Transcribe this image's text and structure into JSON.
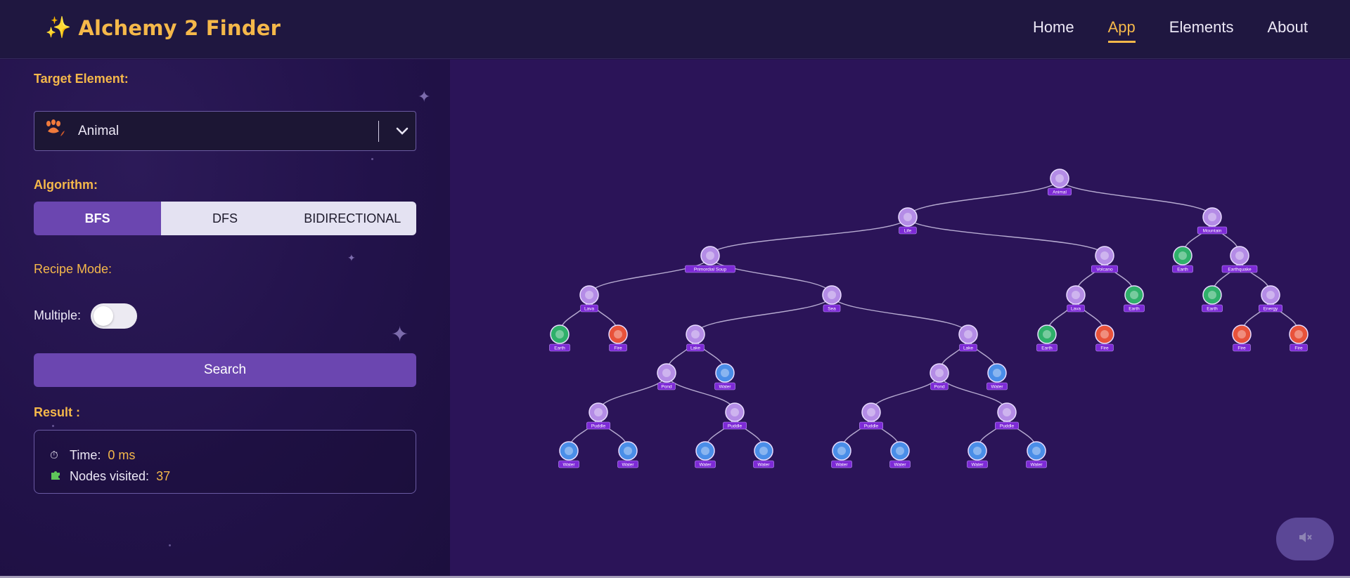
{
  "brand": {
    "icon": "sparkles-icon",
    "title": "Alchemy 2 Finder"
  },
  "nav": {
    "links": [
      "Home",
      "App",
      "Elements",
      "About"
    ],
    "active": "App"
  },
  "sidebar": {
    "target_label": "Target Element:",
    "target_value": "Animal",
    "target_icon": "paw-icon",
    "algorithm_label": "Algorithm:",
    "algorithms": [
      "BFS",
      "DFS",
      "BIDIRECTIONAL"
    ],
    "algorithm_selected": "BFS",
    "recipe_mode_label": "Recipe Mode:",
    "multiple_label": "Multiple:",
    "multiple_enabled": false,
    "search_label": "Search",
    "result_label": "Result :",
    "time_label": "Time:",
    "time_value": "0 ms",
    "time_icon": "stopwatch-icon",
    "nodes_label": "Nodes visited:",
    "nodes_value": "37",
    "nodes_icon": "puzzle-icon"
  },
  "tree": {
    "nodes": [
      {
        "id": "animal",
        "label": "Animal",
        "kind": "compound",
        "parent": null
      },
      {
        "id": "life",
        "label": "Life",
        "kind": "compound",
        "parent": "animal"
      },
      {
        "id": "mountain",
        "label": "Mountain",
        "kind": "compound",
        "parent": "animal"
      },
      {
        "id": "soup",
        "label": "Primordial Soup",
        "kind": "compound",
        "parent": "life"
      },
      {
        "id": "volcano",
        "label": "Volcano",
        "kind": "compound",
        "parent": "life"
      },
      {
        "id": "m_earth",
        "label": "Earth",
        "kind": "earth",
        "parent": "mountain"
      },
      {
        "id": "quake",
        "label": "Earthquake",
        "kind": "compound",
        "parent": "mountain"
      },
      {
        "id": "lava1",
        "label": "Lava",
        "kind": "compound",
        "parent": "soup"
      },
      {
        "id": "sea",
        "label": "Sea",
        "kind": "compound",
        "parent": "soup"
      },
      {
        "id": "lava2",
        "label": "Lava",
        "kind": "compound",
        "parent": "volcano"
      },
      {
        "id": "v_earth",
        "label": "Earth",
        "kind": "earth",
        "parent": "volcano"
      },
      {
        "id": "q_earth",
        "label": "Earth",
        "kind": "earth",
        "parent": "quake"
      },
      {
        "id": "energy",
        "label": "Energy",
        "kind": "compound",
        "parent": "quake"
      },
      {
        "id": "l1_earth",
        "label": "Earth",
        "kind": "earth",
        "parent": "lava1"
      },
      {
        "id": "l1_fire",
        "label": "Fire",
        "kind": "fire",
        "parent": "lava1"
      },
      {
        "id": "lake1",
        "label": "Lake",
        "kind": "compound",
        "parent": "sea"
      },
      {
        "id": "lake2",
        "label": "Lake",
        "kind": "compound",
        "parent": "sea"
      },
      {
        "id": "l2_earth",
        "label": "Earth",
        "kind": "earth",
        "parent": "lava2"
      },
      {
        "id": "l2_fire",
        "label": "Fire",
        "kind": "fire",
        "parent": "lava2"
      },
      {
        "id": "e_fire1",
        "label": "Fire",
        "kind": "fire",
        "parent": "energy"
      },
      {
        "id": "e_fire2",
        "label": "Fire",
        "kind": "fire",
        "parent": "energy"
      },
      {
        "id": "pond1",
        "label": "Pond",
        "kind": "compound",
        "parent": "lake1"
      },
      {
        "id": "lk1_water",
        "label": "Water",
        "kind": "water",
        "parent": "lake1"
      },
      {
        "id": "pond2",
        "label": "Pond",
        "kind": "compound",
        "parent": "lake2"
      },
      {
        "id": "lk2_water",
        "label": "Water",
        "kind": "water",
        "parent": "lake2"
      },
      {
        "id": "pud1",
        "label": "Puddle",
        "kind": "compound",
        "parent": "pond1"
      },
      {
        "id": "pud2",
        "label": "Puddle",
        "kind": "compound",
        "parent": "pond1"
      },
      {
        "id": "pud3",
        "label": "Puddle",
        "kind": "compound",
        "parent": "pond2"
      },
      {
        "id": "pud4",
        "label": "Puddle",
        "kind": "compound",
        "parent": "pond2"
      },
      {
        "id": "w1",
        "label": "Water",
        "kind": "water",
        "parent": "pud1"
      },
      {
        "id": "w2",
        "label": "Water",
        "kind": "water",
        "parent": "pud1"
      },
      {
        "id": "w3",
        "label": "Water",
        "kind": "water",
        "parent": "pud2"
      },
      {
        "id": "w4",
        "label": "Water",
        "kind": "water",
        "parent": "pud2"
      },
      {
        "id": "w5",
        "label": "Water",
        "kind": "water",
        "parent": "pud3"
      },
      {
        "id": "w6",
        "label": "Water",
        "kind": "water",
        "parent": "pud3"
      },
      {
        "id": "w7",
        "label": "Water",
        "kind": "water",
        "parent": "pud4"
      },
      {
        "id": "w8",
        "label": "Water",
        "kind": "water",
        "parent": "pud4"
      }
    ]
  },
  "mute_icon": "speaker-muted-icon",
  "colors": {
    "accent": "#f5b84a",
    "primary": "#6b46b0",
    "node_compound": "#b48ce6",
    "node_water": "#4a8ee8",
    "node_fire": "#e8523a",
    "node_earth": "#2fb06a",
    "label_bg": "#7d2ad6"
  }
}
